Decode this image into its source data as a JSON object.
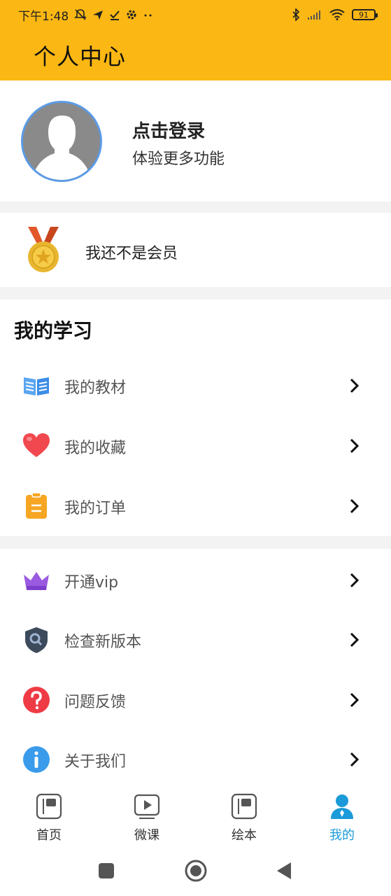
{
  "status_bar": {
    "time": "下午1:48",
    "battery": "91"
  },
  "header": {
    "title": "个人中心"
  },
  "profile": {
    "login_title": "点击登录",
    "login_subtitle": "体验更多功能"
  },
  "membership": {
    "text": "我还不是会员"
  },
  "study": {
    "title": "我的学习",
    "items": [
      {
        "label": "我的教材",
        "icon": "book-icon"
      },
      {
        "label": "我的收藏",
        "icon": "heart-icon"
      },
      {
        "label": "我的订单",
        "icon": "clipboard-icon"
      }
    ]
  },
  "more": {
    "items": [
      {
        "label": "开通vip",
        "icon": "crown-icon"
      },
      {
        "label": "检查新版本",
        "icon": "shield-search-icon"
      },
      {
        "label": "问题反馈",
        "icon": "question-icon"
      },
      {
        "label": "关于我们",
        "icon": "info-icon"
      }
    ]
  },
  "tabs": [
    {
      "label": "首页",
      "icon": "home-book-icon",
      "active": false
    },
    {
      "label": "微课",
      "icon": "video-play-icon",
      "active": false
    },
    {
      "label": "绘本",
      "icon": "picture-book-icon",
      "active": false
    },
    {
      "label": "我的",
      "icon": "user-icon",
      "active": true
    }
  ],
  "colors": {
    "brand": "#FBB713",
    "active_tab": "#1A9AD8",
    "avatar_border": "#5B9BE6"
  }
}
